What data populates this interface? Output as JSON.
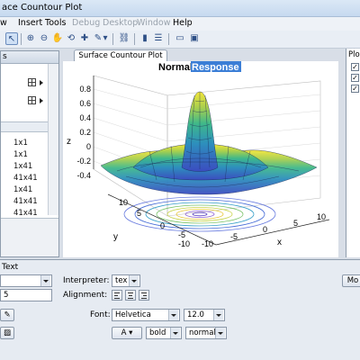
{
  "window": {
    "title": "ace Countour Plot"
  },
  "menu": {
    "items": [
      {
        "label": "w",
        "enabled": true
      },
      {
        "label": "Insert",
        "enabled": true
      },
      {
        "label": "Tools",
        "enabled": true
      },
      {
        "label": "Debug",
        "enabled": false
      },
      {
        "label": "Desktop",
        "enabled": false
      },
      {
        "label": "Window",
        "enabled": false
      },
      {
        "label": "Help",
        "enabled": true
      }
    ]
  },
  "toolbar": {
    "icons": [
      "edit-plot-icon",
      "zoom-in-icon",
      "zoom-out-icon",
      "pan-icon",
      "rotate-3d-icon",
      "data-cursor-icon",
      "brush-icon",
      "link-icon",
      "insert-colorbar-icon",
      "insert-legend-icon",
      "hide-plot-tools-icon",
      "show-plot-tools-icon"
    ]
  },
  "left_panel": {
    "header_label": "s",
    "sizes": [
      "1x1",
      "1x1",
      "1x41",
      "41x41",
      "1x41",
      "41x41",
      "41x41"
    ]
  },
  "tab": {
    "label": "Surface Countour Plot"
  },
  "figure": {
    "title_plain": "Normal",
    "title_selected": "Response",
    "zlabel": "z",
    "xlabel": "x",
    "ylabel": "y",
    "z_ticks": [
      "0.8",
      "0.6",
      "0.4",
      "0.2",
      "0",
      "-0.2",
      "-0.4"
    ],
    "x_ticks": [
      "-10",
      "-5",
      "0",
      "5",
      "10"
    ],
    "y_ticks": [
      "10",
      "5",
      "0",
      "-5",
      "-10"
    ]
  },
  "right_panel": {
    "header_label": "Plo",
    "checks": [
      "✓",
      "✓",
      "✓"
    ]
  },
  "property_editor": {
    "section_label": "Text",
    "interpreter_label": "Interpreter:",
    "interpreter_value": "tex",
    "alignment_label": "Alignment:",
    "font_label": "Font:",
    "font_value": "Helvetica",
    "font_size": "12.0",
    "weight_value": "bold",
    "angle_value": "normal",
    "left_field_value": "5",
    "more_button": "Mo"
  }
}
